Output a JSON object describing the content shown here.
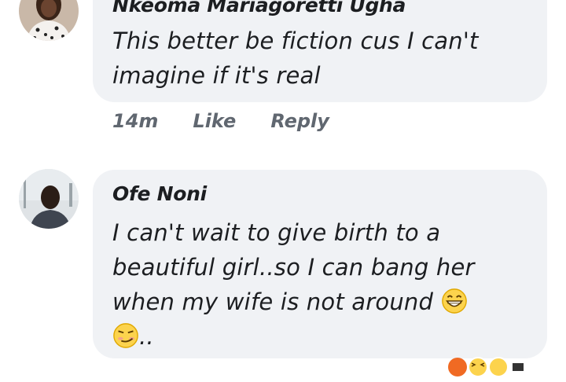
{
  "comments": [
    {
      "author": "Nkeoma Mariagoretti Ugha",
      "lines": [
        "This better be fiction cus I can't",
        "imagine if it's real"
      ],
      "time": "14m",
      "like": "Like",
      "reply": "Reply"
    },
    {
      "author": "Ofe Noni",
      "lines": [
        "I can't wait to give birth to a",
        "beautiful girl..so I can bang her",
        "when my wife is not around"
      ],
      "last_line": "..",
      "emojis": [
        "grinning-face-with-smiling-eyes",
        "smirking-face"
      ]
    }
  ],
  "reaction_icons": [
    "haha-reaction-icon",
    "laughing-reaction-icon"
  ]
}
